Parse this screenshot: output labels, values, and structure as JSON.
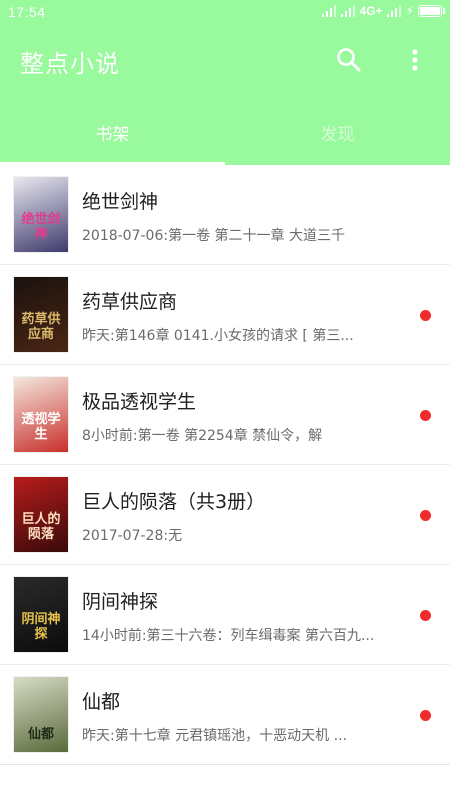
{
  "status_bar": {
    "time": "17:54",
    "network": "4G+",
    "battery_level": 0.9
  },
  "app_bar": {
    "title": "整点小说",
    "icons": [
      "search-icon",
      "more-vert-icon"
    ],
    "colors": {
      "primary": "#99f99d",
      "update_dot": "#f02b2b"
    }
  },
  "tabs": [
    {
      "label": "书架",
      "active": true
    },
    {
      "label": "发现",
      "active": false
    }
  ],
  "books": [
    {
      "title": "绝世剑神",
      "meta": "2018-07-06:第一卷 第二十一章 大道三千",
      "has_update": false,
      "cover": {
        "bg1": "#e8e8f0",
        "bg2": "#3f3b6d",
        "text": "绝世剑神",
        "text_color": "#e53a8f"
      }
    },
    {
      "title": "药草供应商",
      "meta": "昨天:第146章 0141.小女孩的请求 [ 第三...",
      "has_update": true,
      "cover": {
        "bg1": "#1b120e",
        "bg2": "#4a2615",
        "text": "药草供应商",
        "text_color": "#d9b96b"
      }
    },
    {
      "title": "极品透视学生",
      "meta": "8小时前:第一卷 第2254章 禁仙令，解",
      "has_update": true,
      "cover": {
        "bg1": "#f4e7dd",
        "bg2": "#c8302c",
        "text": "透视学生",
        "text_color": "#ffffff"
      }
    },
    {
      "title": "巨人的陨落（共3册）",
      "meta": "2017-07-28:无",
      "has_update": true,
      "cover": {
        "bg1": "#b71c1c",
        "bg2": "#3a0a0a",
        "text": "巨人的陨落",
        "text_color": "#ffe0c0"
      }
    },
    {
      "title": "阴间神探",
      "meta": "14小时前:第三十六卷：列车缉毒案 第六百九...",
      "has_update": true,
      "cover": {
        "bg1": "#2a2a2a",
        "bg2": "#0c0c0c",
        "text": "阴间神探",
        "text_color": "#e6c34a"
      }
    },
    {
      "title": "仙都",
      "meta": "昨天:第十七章 元君镇瑶池，十恶动天机 ...",
      "has_update": true,
      "cover": {
        "bg1": "#d7dcc6",
        "bg2": "#5a6a3b",
        "text": "仙都",
        "text_color": "#1f2b16"
      }
    }
  ]
}
